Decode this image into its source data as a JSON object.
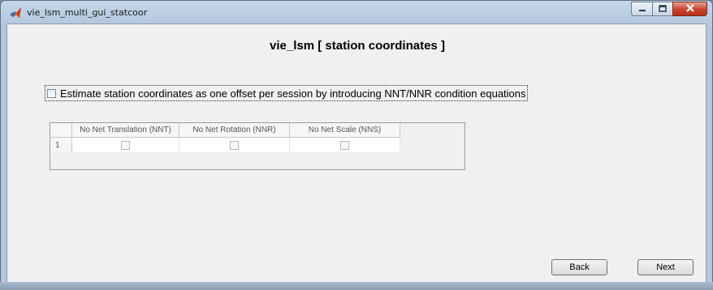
{
  "window": {
    "title": "vie_lsm_multi_gui_statcoor"
  },
  "main": {
    "heading": "vie_lsm [ station coordinates ]",
    "estimate_checkbox": {
      "label": "Estimate station coordinates as one offset per session by introducing NNT/NNR condition equations",
      "checked": false
    },
    "table": {
      "columns": [
        "No Net Translation (NNT)",
        "No Net Rotation (NNR)",
        "No Net Scale (NNS)"
      ],
      "rows": [
        {
          "label": "1",
          "values": [
            false,
            false,
            false
          ]
        }
      ]
    }
  },
  "buttons": {
    "back": "Back",
    "next": "Next"
  },
  "colors": {
    "client_bg": "#f0f0f0",
    "titlebar": "#c5d6e8",
    "close_button": "#c7432e"
  },
  "icons": {
    "app": "matlab-icon",
    "minimize": "minimize-icon",
    "maximize": "maximize-icon",
    "close": "close-icon"
  }
}
